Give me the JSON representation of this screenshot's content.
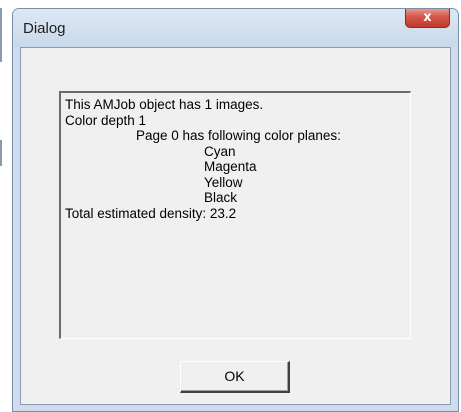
{
  "window": {
    "title": "Dialog",
    "close_glyph": "x",
    "close_icon": "close-icon"
  },
  "message": {
    "lines": [
      "This AMJob object has 1 images.",
      "Color depth 1",
      "Page 0 has following color planes:",
      "Cyan",
      "Magenta",
      "Yellow",
      "Black",
      "Total estimated density: 23.2"
    ]
  },
  "buttons": {
    "ok_label": "OK"
  },
  "colors": {
    "titlebar": "#cfdced",
    "close_button": "#c0392b",
    "client_background": "#f0f0f0"
  }
}
